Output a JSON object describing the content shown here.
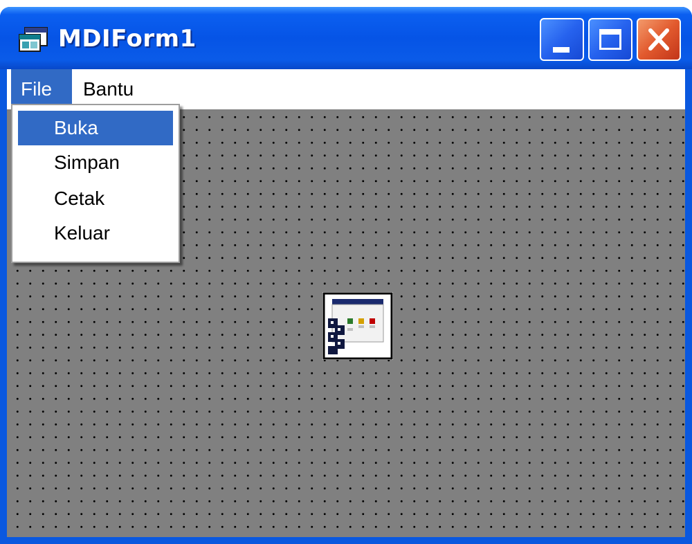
{
  "window": {
    "title": "MDIForm1",
    "title_icon": "mdi-form-icon"
  },
  "caption_buttons": {
    "minimize_icon": "minimize-icon",
    "maximize_icon": "maximize-icon",
    "close_icon": "close-icon"
  },
  "menubar": {
    "items": [
      {
        "label": "File",
        "active": true
      },
      {
        "label": "Bantu",
        "active": false
      }
    ]
  },
  "file_menu": {
    "items": [
      {
        "label": "Buka",
        "highlighted": true
      },
      {
        "label": "Simpan",
        "highlighted": false
      },
      {
        "label": "Cetak",
        "highlighted": false
      },
      {
        "label": "Keluar",
        "highlighted": false
      }
    ]
  },
  "client_area": {
    "background_color": "#808080",
    "center_icon": "form-designer-icon"
  },
  "colors": {
    "titlebar": "#0654e6",
    "menu_highlight": "#316ac5",
    "close_button": "#e25a2e"
  }
}
